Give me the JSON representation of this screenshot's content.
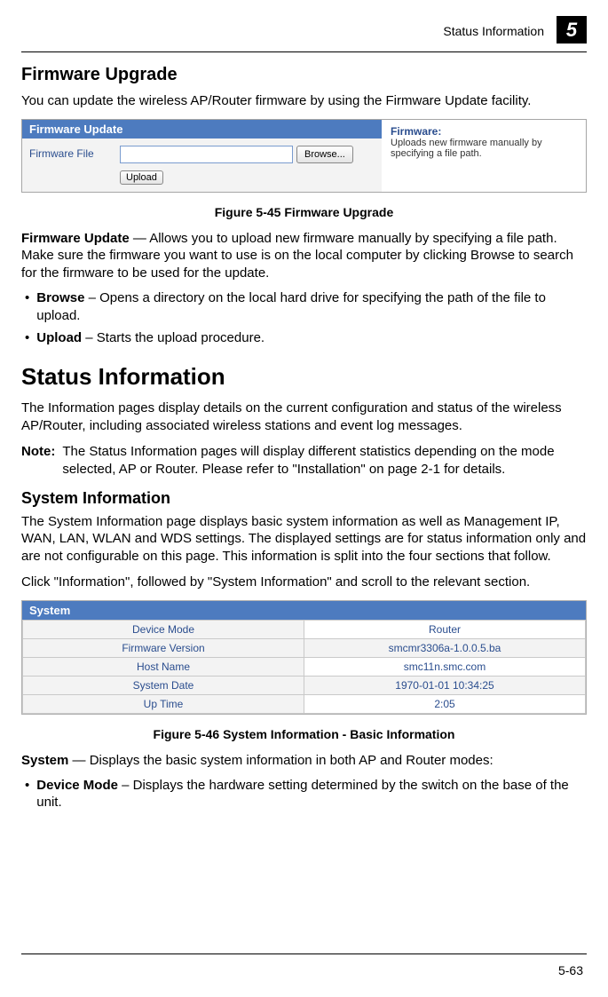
{
  "header": {
    "label": "Status Information",
    "chapter": "5"
  },
  "firmware": {
    "title": "Firmware Upgrade",
    "intro": "You can update the wireless AP/Router firmware by using the Firmware Update facility.",
    "panel_title": "Firmware Update",
    "row_label": "Firmware File",
    "browse_btn": "Browse...",
    "upload_btn": "Upload",
    "right_label": "Firmware:",
    "right_text": "Uploads new firmware manually by specifying a file path.",
    "caption": "Figure 5-45  Firmware Upgrade",
    "desc_lead": "Firmware Update",
    "desc_body": " — Allows you to upload new firmware manually by specifying a file path. Make sure the firmware you want to use is on the local computer by clicking Browse to search for the firmware to be used for the update.",
    "bullets": [
      {
        "strong": "Browse",
        "text": " – Opens a directory on the local hard drive for specifying the path of the file to upload."
      },
      {
        "strong": "Upload",
        "text": " – Starts the upload procedure."
      }
    ]
  },
  "status": {
    "title": "Status Information",
    "intro": "The Information pages display details on the current configuration and status of the wireless AP/Router, including associated wireless stations and event log messages.",
    "note_label": "Note:",
    "note_text": "The Status Information pages will display different statistics depending on the mode selected, AP or Router. Please refer to \"Installation\" on page 2-1 for details."
  },
  "sysinfo": {
    "title": "System Information",
    "p1": "The System Information page displays basic system information as well as Management IP, WAN, LAN, WLAN and WDS settings. The displayed settings are for status information only and are not configurable on this page. This information is split into the four sections that follow.",
    "p2": "Click \"Information\", followed by \"System Information\" and scroll to the relevant section.",
    "table_title": "System",
    "rows": [
      {
        "k": "Device Mode",
        "v": "Router"
      },
      {
        "k": "Firmware Version",
        "v": "smcmr3306a-1.0.0.5.ba"
      },
      {
        "k": "Host Name",
        "v": "smc11n.smc.com"
      },
      {
        "k": "System Date",
        "v": "1970-01-01 10:34:25"
      },
      {
        "k": "Up Time",
        "v": "2:05"
      }
    ],
    "caption": "Figure 5-46  System Information - Basic Information",
    "desc_lead": "System",
    "desc_body": " — Displays the basic system information in both AP and Router modes:",
    "bullets": [
      {
        "strong": "Device Mode",
        "text": " – Displays the hardware setting determined by the switch on the base of the unit."
      }
    ]
  },
  "page_number": "5-63"
}
